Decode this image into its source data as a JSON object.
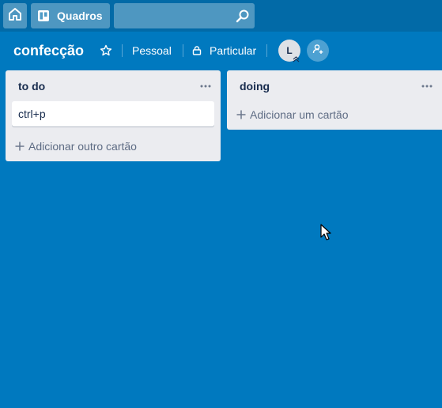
{
  "header": {
    "home_icon": "house-icon",
    "boards_label": "Quadros",
    "boards_icon": "boards-icon",
    "search_value": "",
    "search_placeholder": "",
    "search_icon": "magnifier-icon"
  },
  "board": {
    "title": "confecção",
    "star_icon": "star-icon",
    "team": "Pessoal",
    "visibility": "Particular",
    "visibility_icon": "lock-icon",
    "member_initial": "L",
    "invite_icon": "add-member-icon"
  },
  "lists": [
    {
      "title": "to do",
      "cards": [
        "ctrl+p"
      ],
      "add_label": "Adicionar outro cartão"
    },
    {
      "title": "doing",
      "cards": [],
      "add_label": "Adicionar um cartão"
    }
  ],
  "colors": {
    "background": "#0079bf",
    "topbar": "#026aa7",
    "list": "#ebecf0",
    "card": "#ffffff"
  }
}
